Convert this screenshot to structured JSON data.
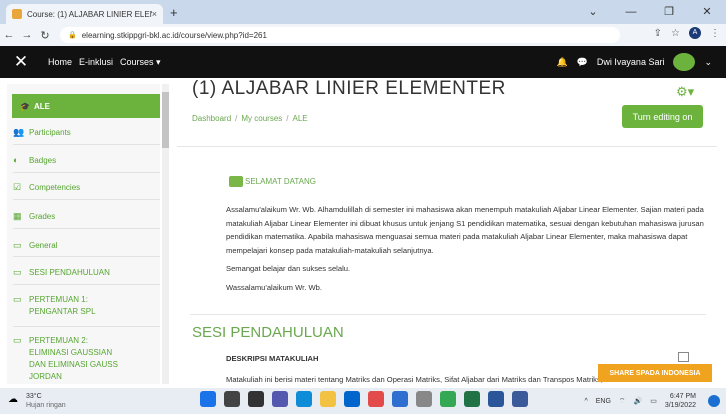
{
  "browser": {
    "tab_title": "Course: (1) ALJABAR LINIER ELEN",
    "tab_close": "×",
    "new_tab": "+",
    "url": "elearning.stkippgri-bkl.ac.id/course/view.php?id=261",
    "profile_initial": "A"
  },
  "topbar": {
    "menu_icon": "✕",
    "nav": [
      "Home",
      "E-inklusi",
      "Courses ▾"
    ],
    "user_name": "Dwi Ivayana Sari"
  },
  "sidebar": {
    "active": "ALE",
    "items": [
      {
        "label": "Participants",
        "icon": "users-icon",
        "glyph": "👥"
      },
      {
        "label": "Badges",
        "icon": "badge-icon",
        "glyph": "◐"
      },
      {
        "label": "Competencies",
        "icon": "check-icon",
        "glyph": "☑"
      },
      {
        "label": "Grades",
        "icon": "table-icon",
        "glyph": "▦"
      },
      {
        "label": "General",
        "icon": "folder-icon",
        "glyph": "▭"
      },
      {
        "label": "SESI PENDAHULUAN",
        "icon": "folder-icon",
        "glyph": "▭"
      },
      {
        "label": "PERTEMUAN 1: PENGANTAR SPL",
        "icon": "folder-icon",
        "glyph": "▭"
      },
      {
        "label": "PERTEMUAN 2: ELIMINASI GAUSSIAN DAN ELIMINASI GAUSS JORDAN",
        "icon": "folder-icon",
        "glyph": "▭"
      }
    ]
  },
  "main": {
    "title": "(1) ALJABAR LINIER ELEMENTER",
    "breadcrumb": [
      "Dashboard",
      "My courses",
      "ALE"
    ],
    "edit_button": "Turn editing on",
    "welcome_link": "SELAMAT DATANG",
    "paragraph1": "Assalamu'alaikum Wr. Wb. Alhamdulillah di semester ini mahasiswa akan menempuh matakuliah Aljabar Linear Elementer. Sajian materi pada matakuliah Aljabar Linear Elementer ini dibuat khusus untuk jenjang S1 pendidikan matematika, sesuai dengan kebutuhan mahasiswa jurusan pendidikan matematika. Apabila mahasiswa menguasai semua materi pada matakuliah Aljabar Linear Elementer, maka mahasiswa dapat mempelajari konsep pada matakuliah-matakuliah selanjutnya.",
    "paragraph2": "Semangat belajar dan sukses selalu.",
    "paragraph3": "Wassalamu'alaikum Wr. Wb.",
    "section_title": "SESI PENDAHULUAN",
    "desc_title": "DESKRIPSI MATAKULIAH",
    "desc_text": "Matakuliah ini berisi materi tentang Matriks dan Operasi Matriks, Sifat Aljabar dari Matriks dan Transpos Matriks, Matriks",
    "share_button": "SHARE SPADA INDONESIA"
  },
  "taskbar": {
    "temp": "33°C",
    "weather": "Hujan ringan",
    "lang": "ENG",
    "time": "6:47 PM",
    "date": "3/19/2022"
  },
  "colors": {
    "accent": "#6cb33e",
    "share": "#f0a31e"
  }
}
